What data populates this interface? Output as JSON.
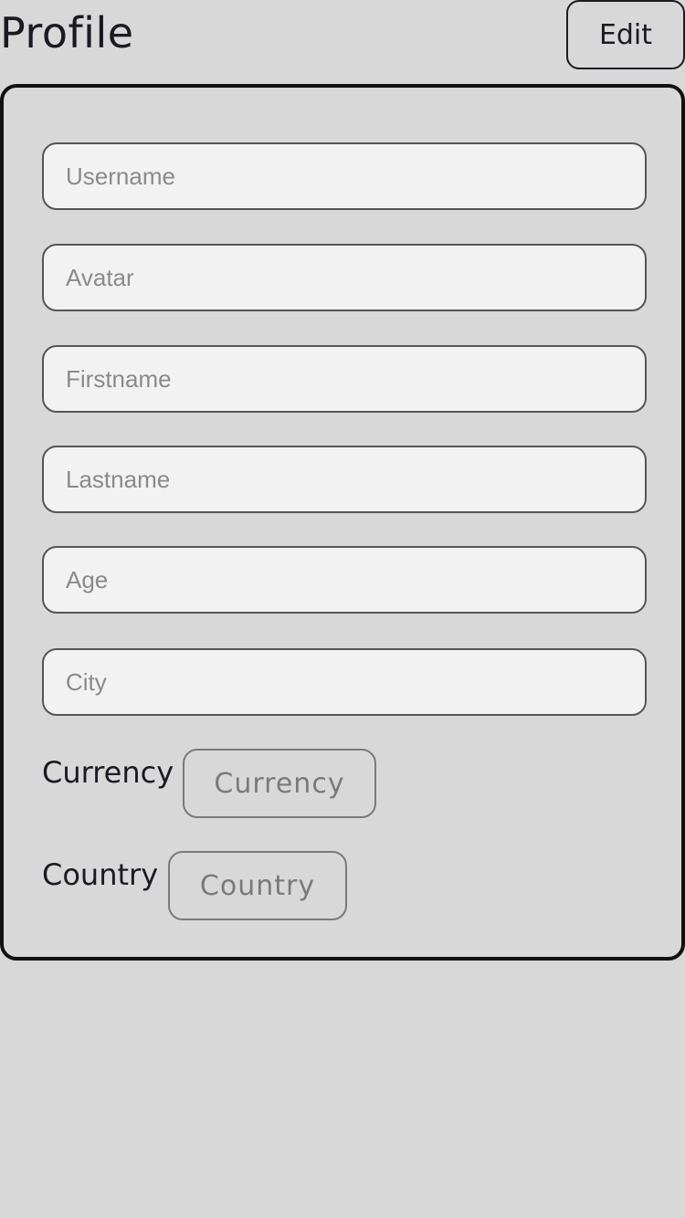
{
  "header": {
    "title": "Profile",
    "edit_label": "Edit"
  },
  "form": {
    "fields": [
      {
        "name": "username",
        "placeholder": "Username",
        "value": ""
      },
      {
        "name": "avatar",
        "placeholder": "Avatar",
        "value": ""
      },
      {
        "name": "firstname",
        "placeholder": "Firstname",
        "value": ""
      },
      {
        "name": "lastname",
        "placeholder": "Lastname",
        "value": ""
      },
      {
        "name": "age",
        "placeholder": "Age",
        "value": ""
      },
      {
        "name": "city",
        "placeholder": "City",
        "value": ""
      }
    ],
    "currency": {
      "label": "Currency",
      "button_label": "Currency"
    },
    "country": {
      "label": "Country",
      "button_label": "Country"
    }
  },
  "colors": {
    "background": "#d8d8d8",
    "text": "#1a1a22",
    "card_border": "#111111",
    "input_background": "#f2f2f2",
    "input_border": "#555555",
    "placeholder": "#8a8a8a",
    "picker_muted": "#7a7a7a"
  }
}
